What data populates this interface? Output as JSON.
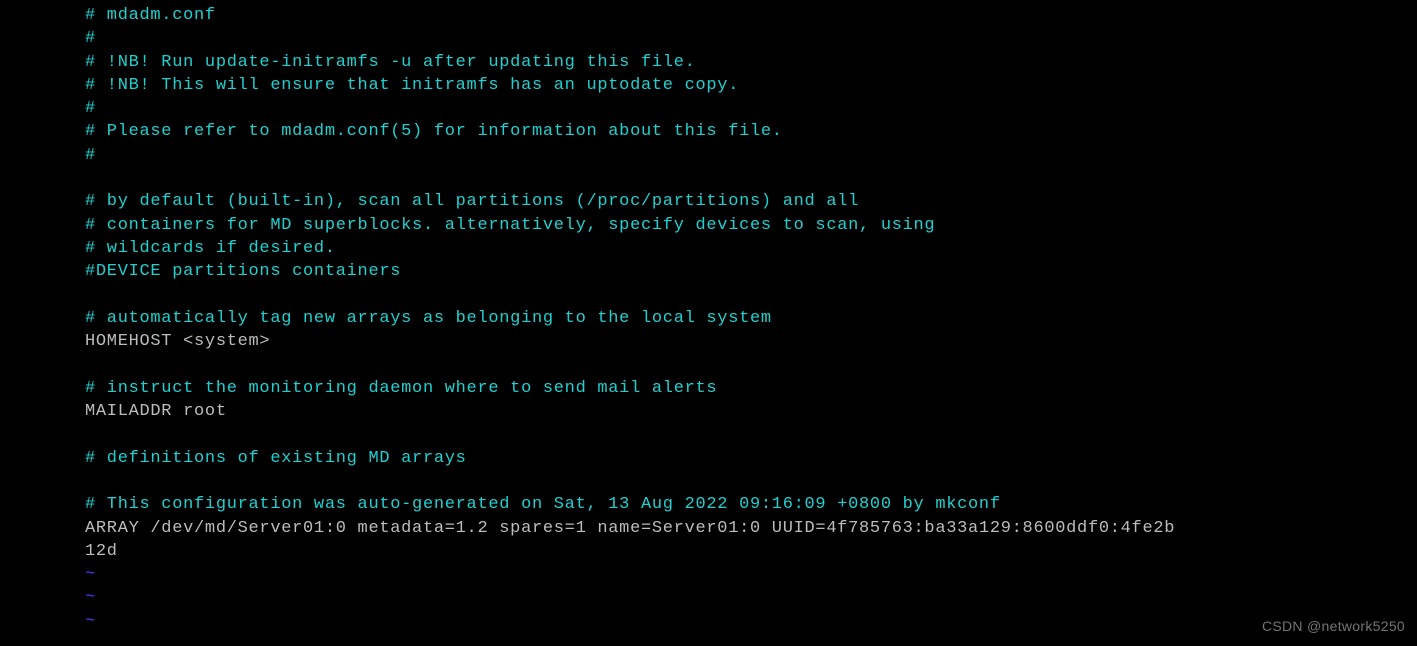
{
  "lines": [
    {
      "cls": "comment",
      "text": "# mdadm.conf"
    },
    {
      "cls": "comment",
      "text": "#"
    },
    {
      "cls": "comment",
      "text": "# !NB! Run update-initramfs -u after updating this file."
    },
    {
      "cls": "comment",
      "text": "# !NB! This will ensure that initramfs has an uptodate copy."
    },
    {
      "cls": "comment",
      "text": "#"
    },
    {
      "cls": "comment",
      "text": "# Please refer to mdadm.conf(5) for information about this file."
    },
    {
      "cls": "comment",
      "text": "#"
    },
    {
      "cls": "normal",
      "text": ""
    },
    {
      "cls": "comment",
      "text": "# by default (built-in), scan all partitions (/proc/partitions) and all"
    },
    {
      "cls": "comment",
      "text": "# containers for MD superblocks. alternatively, specify devices to scan, using"
    },
    {
      "cls": "comment",
      "text": "# wildcards if desired."
    },
    {
      "cls": "comment",
      "text": "#DEVICE partitions containers"
    },
    {
      "cls": "normal",
      "text": ""
    },
    {
      "cls": "comment",
      "text": "# automatically tag new arrays as belonging to the local system"
    },
    {
      "cls": "normal",
      "text": "HOMEHOST <system>"
    },
    {
      "cls": "normal",
      "text": ""
    },
    {
      "cls": "comment",
      "text": "# instruct the monitoring daemon where to send mail alerts"
    },
    {
      "cls": "normal",
      "text": "MAILADDR root"
    },
    {
      "cls": "normal",
      "text": ""
    },
    {
      "cls": "comment",
      "text": "# definitions of existing MD arrays"
    },
    {
      "cls": "normal",
      "text": ""
    },
    {
      "cls": "comment",
      "text": "# This configuration was auto-generated on Sat, 13 Aug 2022 09:16:09 +0800 by mkconf"
    },
    {
      "cls": "normal",
      "text": "ARRAY /dev/md/Server01:0 metadata=1.2 spares=1 name=Server01:0 UUID=4f785763:ba33a129:8600ddf0:4fe2b"
    },
    {
      "cls": "normal",
      "text": "12d"
    },
    {
      "cls": "tilde",
      "text": "~"
    },
    {
      "cls": "tilde",
      "text": "~"
    },
    {
      "cls": "tilde",
      "text": "~"
    }
  ],
  "watermark": "CSDN @network5250"
}
